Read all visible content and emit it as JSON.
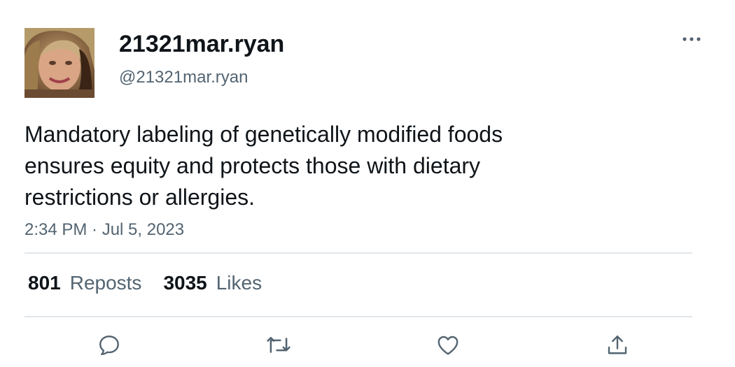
{
  "user": {
    "display_name": "21321mar.ryan",
    "handle": "@21321mar.ryan",
    "avatar_icon": "profile-photo"
  },
  "tweet": {
    "text": "Mandatory labeling of genetically modified foods\nensures equity and protects those with dietary\nrestrictions or allergies.",
    "timestamp": "2:34 PM · Jul 5, 2023"
  },
  "stats": {
    "reposts_count": "801",
    "reposts_label": "Reposts",
    "likes_count": "3035",
    "likes_label": "Likes"
  },
  "actions": {
    "reply_icon": "reply-icon",
    "repost_icon": "repost-icon",
    "like_icon": "heart-icon",
    "share_icon": "share-icon",
    "more_icon": "more-horizontal-icon"
  },
  "colors": {
    "text_primary": "#0f1419",
    "text_secondary": "#536471",
    "divider": "#e1e6ea",
    "icon": "#536471"
  }
}
